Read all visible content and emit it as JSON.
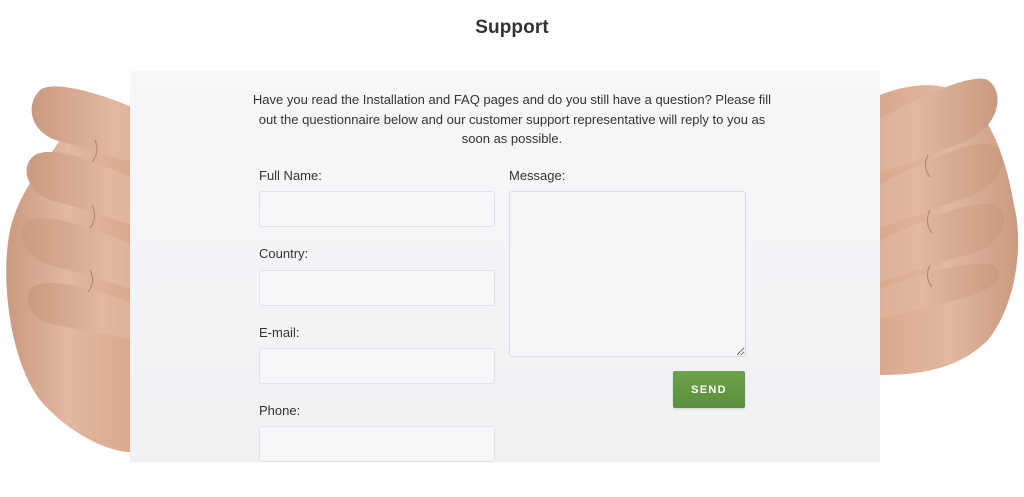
{
  "page": {
    "title": "Support"
  },
  "form": {
    "intro": "Have you read the Installation and FAQ pages and do you still have a question? Please fill out the questionnaire below and our customer support representative will reply to you as soon as possible.",
    "full_name": {
      "label": "Full Name:",
      "value": "",
      "placeholder": ""
    },
    "country": {
      "label": "Country:",
      "value": "",
      "placeholder": ""
    },
    "email": {
      "label": "E-mail:",
      "value": "",
      "placeholder": ""
    },
    "phone": {
      "label": "Phone:",
      "value": "",
      "placeholder": ""
    },
    "message": {
      "label": "Message:",
      "value": "",
      "placeholder": ""
    },
    "send_label": "SEND"
  },
  "colors": {
    "button": "#5f9341",
    "paper": "#f5f5f7",
    "text": "#333333"
  }
}
